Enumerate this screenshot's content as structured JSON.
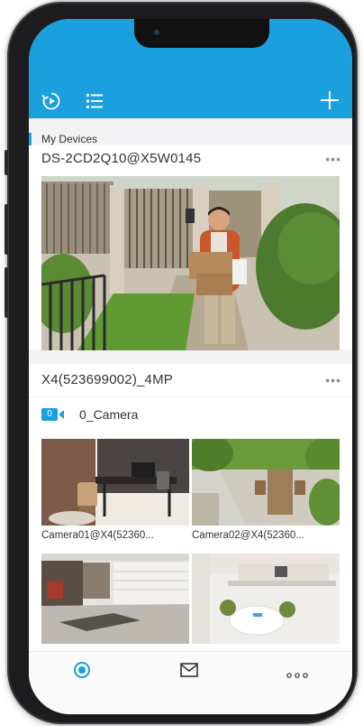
{
  "header": {
    "playback_icon": "playback-icon",
    "list_icon": "list-icon",
    "add_icon": "plus-icon",
    "color": "#1aa0de"
  },
  "section": {
    "label": "My Devices"
  },
  "devices": [
    {
      "name": "DS-2CD2Q10@X5W0145",
      "more": "•••"
    },
    {
      "name": "X4(523699002)_4MP",
      "more": "•••",
      "channel_group": {
        "badge": "0",
        "label": "0_Camera"
      },
      "cameras": [
        {
          "name": "Camera01@X4(52360..."
        },
        {
          "name": "Camera02@X4(52360..."
        }
      ]
    }
  ],
  "tabbar": {
    "items": [
      {
        "icon": "camera-tab-icon",
        "active": true
      },
      {
        "icon": "message-tab-icon",
        "active": false
      },
      {
        "icon": "more-tab-icon",
        "active": false
      }
    ]
  }
}
